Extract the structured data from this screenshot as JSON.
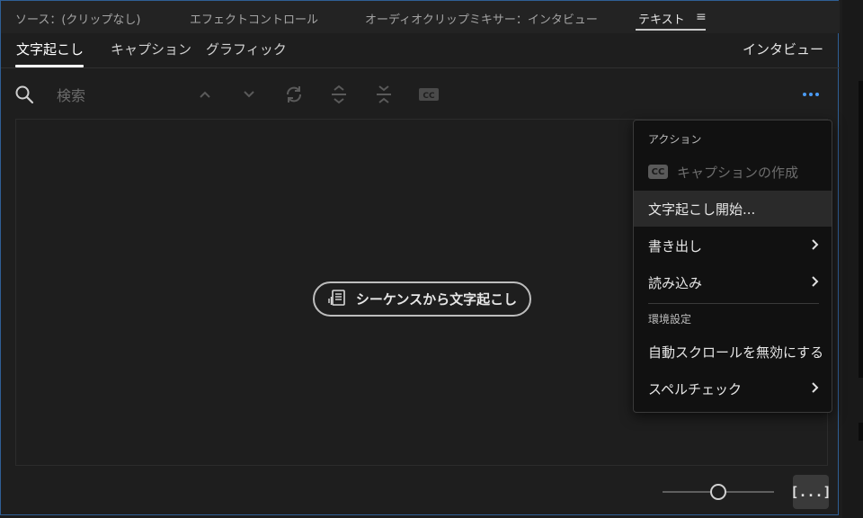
{
  "panel_tabs": [
    {
      "label": "ソース：(クリップなし)"
    },
    {
      "label": "エフェクトコントロール"
    },
    {
      "label": "オーディオクリップミキサー：インタビュー"
    },
    {
      "label": "テキスト",
      "active": true
    }
  ],
  "panel_menu_glyph": "≡",
  "sub_tabs": [
    {
      "label": "文字起こし",
      "active": true
    },
    {
      "label": "キャプション"
    },
    {
      "label": "グラフィック"
    }
  ],
  "sequence_name": "インタビュー",
  "search": {
    "placeholder": "検索",
    "value": ""
  },
  "toolbar_icons": [
    "search-icon",
    "chevron-up-icon",
    "chevron-down-icon",
    "replace-icon",
    "split-icon",
    "merge-icon",
    "cc-icon",
    "more-icon"
  ],
  "transcribe_button": {
    "label": "シーケンスから文字起こし",
    "icon": "transcript-icon"
  },
  "zoom_slider": {
    "value": 0.5
  },
  "bracket_button": {
    "label": "[...]"
  },
  "dropdown": {
    "actions_header": "アクション",
    "items": [
      {
        "label": "キャプションの作成",
        "disabled": true,
        "badge": "CC"
      },
      {
        "label": "文字起こし開始...",
        "hovered": true
      },
      {
        "label": "書き出し",
        "submenu": true
      },
      {
        "label": "読み込み",
        "submenu": true
      }
    ],
    "prefs_header": "環境設定",
    "pref_items": [
      {
        "label": "自動スクロールを無効にする"
      },
      {
        "label": "スペルチェック",
        "submenu": true
      }
    ]
  },
  "colors": {
    "accent": "#4b9cf5",
    "panel_border": "#2f5f95",
    "menu_bg": "#111111"
  }
}
